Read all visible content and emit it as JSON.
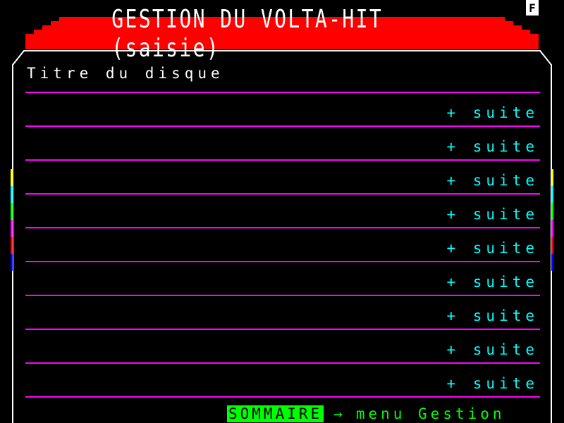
{
  "header": {
    "title": "GESTION DU VOLTA-HIT (saisie)",
    "indicator": "F"
  },
  "form": {
    "field_label": "Titre du disque",
    "rows": [
      {
        "action": "+ suite"
      },
      {
        "action": "+ suite"
      },
      {
        "action": "+ suite"
      },
      {
        "action": "+ suite"
      },
      {
        "action": "+ suite"
      },
      {
        "action": "+ suite"
      },
      {
        "action": "+ suite"
      },
      {
        "action": "+ suite"
      },
      {
        "action": "+ suite"
      }
    ]
  },
  "footer": {
    "key_label": "SOMMAIRE",
    "arrow": "→",
    "text": "menu Gestion"
  },
  "colors": {
    "title_bar": "#ff0000",
    "separator": "#ff00ff",
    "action_text": "#00ffff",
    "key_bg": "#00ff00",
    "background": "#000000"
  }
}
